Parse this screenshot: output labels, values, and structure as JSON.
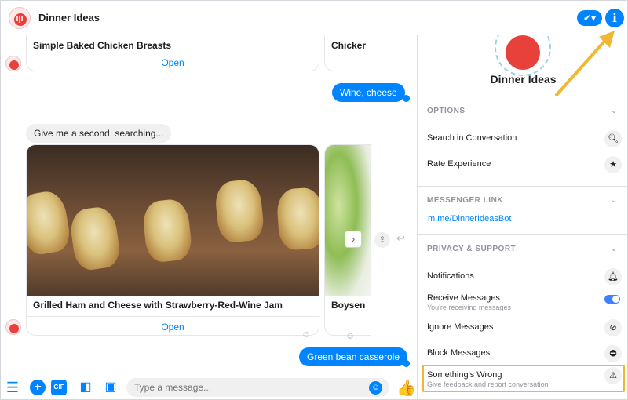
{
  "header": {
    "title": "Dinner Ideas"
  },
  "chat": {
    "card_top": {
      "title": "Simple Baked Chicken Breasts",
      "open": "Open",
      "next_title": "Chicker"
    },
    "msg_out_1": "Wine, cheese",
    "msg_in_1": "Give me a second, searching...",
    "card_main": {
      "title": "Grilled Ham and Cheese with Strawberry-Red-Wine Jam",
      "open": "Open",
      "next_title": "Boysen"
    },
    "msg_out_2": "Green bean casserole"
  },
  "composer": {
    "placeholder": "Type a message...",
    "gif_label": "GIF"
  },
  "sidebar": {
    "title": "Dinner Ideas",
    "options_header": "OPTIONS",
    "options": [
      {
        "label": "Search in Conversation",
        "icon": "search-icon"
      },
      {
        "label": "Rate Experience",
        "icon": "star-icon"
      }
    ],
    "link_header": "MESSENGER LINK",
    "link": "m.me/DinnerIdeasBot",
    "privacy_header": "PRIVACY & SUPPORT",
    "privacy": [
      {
        "label": "Notifications",
        "icon": "bell-icon"
      },
      {
        "label": "Receive Messages",
        "sub": "You're receiving messages",
        "icon": "toggle-on"
      },
      {
        "label": "Ignore Messages",
        "icon": "ignore-icon"
      },
      {
        "label": "Block Messages",
        "icon": "block-icon"
      },
      {
        "label": "Something's Wrong",
        "sub": "Give feedback and report conversation",
        "icon": "warning-icon"
      }
    ]
  },
  "colors": {
    "accent": "#0084ff",
    "highlight": "#f2b731"
  }
}
